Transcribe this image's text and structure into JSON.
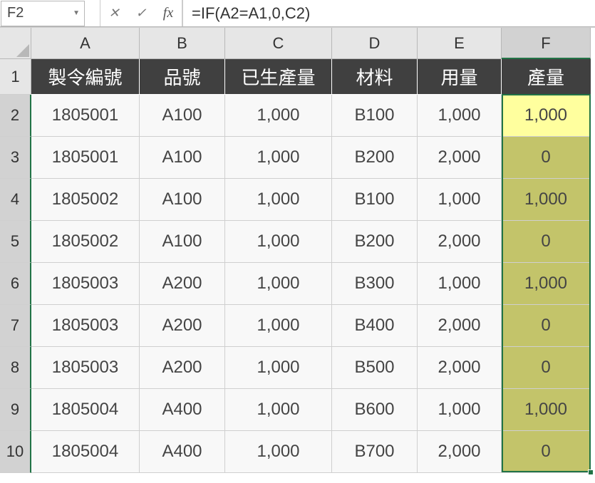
{
  "nameBox": "F2",
  "formula": "=IF(A2=A1,0,C2)",
  "fxLabel": "fx",
  "cancelIcon": "✕",
  "enterIcon": "✓",
  "columns": [
    "A",
    "B",
    "C",
    "D",
    "E",
    "F"
  ],
  "rows": [
    "1",
    "2",
    "3",
    "4",
    "5",
    "6",
    "7",
    "8",
    "9",
    "10"
  ],
  "headers": [
    "製令編號",
    "品號",
    "已生產量",
    "材料",
    "用量",
    "產量"
  ],
  "data": [
    {
      "a": "1805001",
      "b": "A100",
      "c": "1,000",
      "d": "B100",
      "e": "1,000",
      "f": "1,000"
    },
    {
      "a": "1805001",
      "b": "A100",
      "c": "1,000",
      "d": "B200",
      "e": "2,000",
      "f": "0"
    },
    {
      "a": "1805002",
      "b": "A100",
      "c": "1,000",
      "d": "B100",
      "e": "1,000",
      "f": "1,000"
    },
    {
      "a": "1805002",
      "b": "A100",
      "c": "1,000",
      "d": "B200",
      "e": "2,000",
      "f": "0"
    },
    {
      "a": "1805003",
      "b": "A200",
      "c": "1,000",
      "d": "B300",
      "e": "1,000",
      "f": "1,000"
    },
    {
      "a": "1805003",
      "b": "A200",
      "c": "1,000",
      "d": "B400",
      "e": "2,000",
      "f": "0"
    },
    {
      "a": "1805003",
      "b": "A200",
      "c": "1,000",
      "d": "B500",
      "e": "2,000",
      "f": "0"
    },
    {
      "a": "1805004",
      "b": "A400",
      "c": "1,000",
      "d": "B600",
      "e": "1,000",
      "f": "1,000"
    },
    {
      "a": "1805004",
      "b": "A400",
      "c": "1,000",
      "d": "B700",
      "e": "2,000",
      "f": "0"
    }
  ]
}
